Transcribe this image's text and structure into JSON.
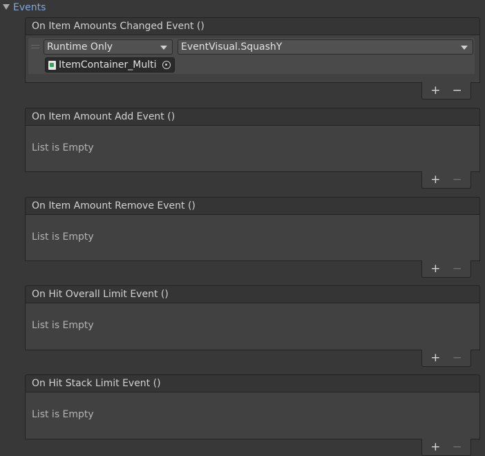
{
  "foldout": {
    "label": "Events",
    "icon": "triangle-down-icon"
  },
  "events": [
    {
      "title": "On Item Amounts Changed Event ()",
      "empty_text": "",
      "listener": {
        "mode": "Runtime Only",
        "function": "EventVisual.SquashY",
        "target_object": "ItemContainer_Multi"
      },
      "add_label": "+",
      "remove_label": "−",
      "remove_enabled": true
    },
    {
      "title": "On Item Amount Add Event ()",
      "empty_text": "List is Empty",
      "add_label": "+",
      "remove_label": "−",
      "remove_enabled": false
    },
    {
      "title": "On Item Amount Remove Event ()",
      "empty_text": "List is Empty",
      "add_label": "+",
      "remove_label": "−",
      "remove_enabled": false
    },
    {
      "title": "On Hit Overall Limit Event ()",
      "empty_text": "List is Empty",
      "add_label": "+",
      "remove_label": "−",
      "remove_enabled": false
    },
    {
      "title": "On Hit Stack Limit Event ()",
      "empty_text": "List is Empty",
      "add_label": "+",
      "remove_label": "−",
      "remove_enabled": false
    }
  ],
  "colors": {
    "background": "#383838",
    "foldout_label": "#7fa6e0",
    "panel": "#414141",
    "header": "#353535"
  }
}
